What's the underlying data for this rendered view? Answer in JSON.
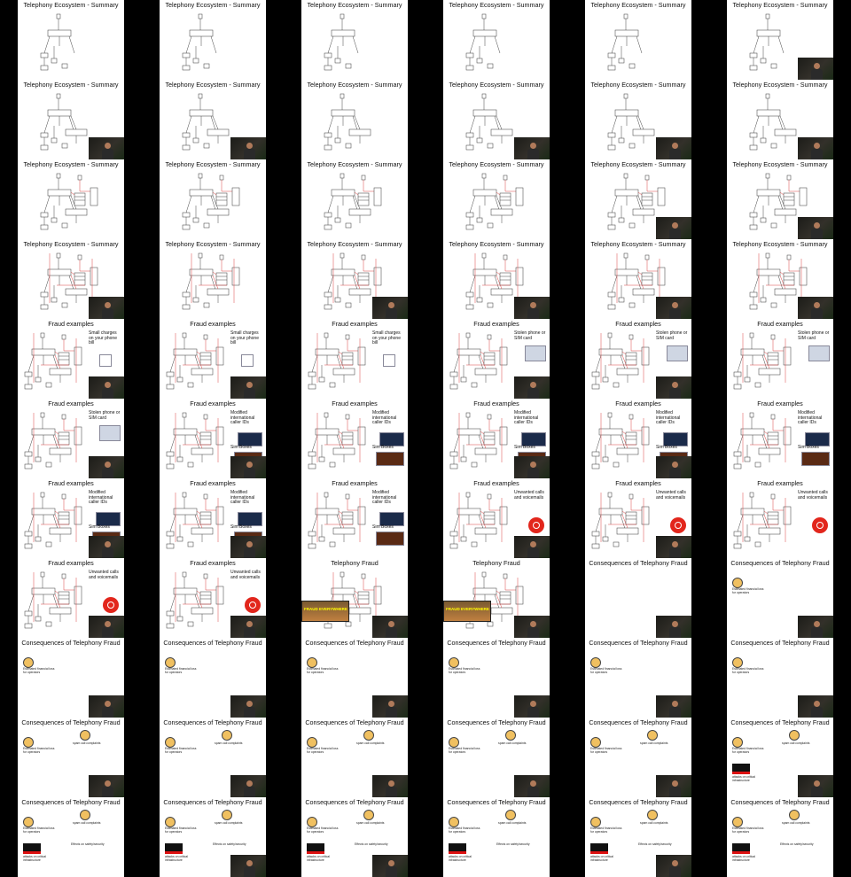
{
  "slide_titles": {
    "ecosystem": "Telephony Ecosystem - Summary",
    "fraud_examples": "Fraud examples",
    "telephony_fraud": "Telephony Fraud",
    "consequences": "Consequences of Telephony Fraud"
  },
  "bullets": {
    "small_charges": "Small charges on your phone bill",
    "stolen_phone": "Stolen phone or SIM card",
    "modified_ids": "Modified international caller IDs",
    "sim_boxes": "Sim Boxes",
    "unwanted_calls": "Unwanted calls and voicemails"
  },
  "meme_text": {
    "top": "FRAUD",
    "bottom": "FRAUD EVERYWHERE"
  },
  "consequences_text": {
    "loss": "Estimated financial loss for operators",
    "spam": "spam call complaints",
    "infra": "attacks on critical infrastructure",
    "security": "Effects on safety/security"
  },
  "colors": {
    "slide_bg": "#ffffff",
    "page_bg": "#000000",
    "accent_red": "#e2261c"
  }
}
